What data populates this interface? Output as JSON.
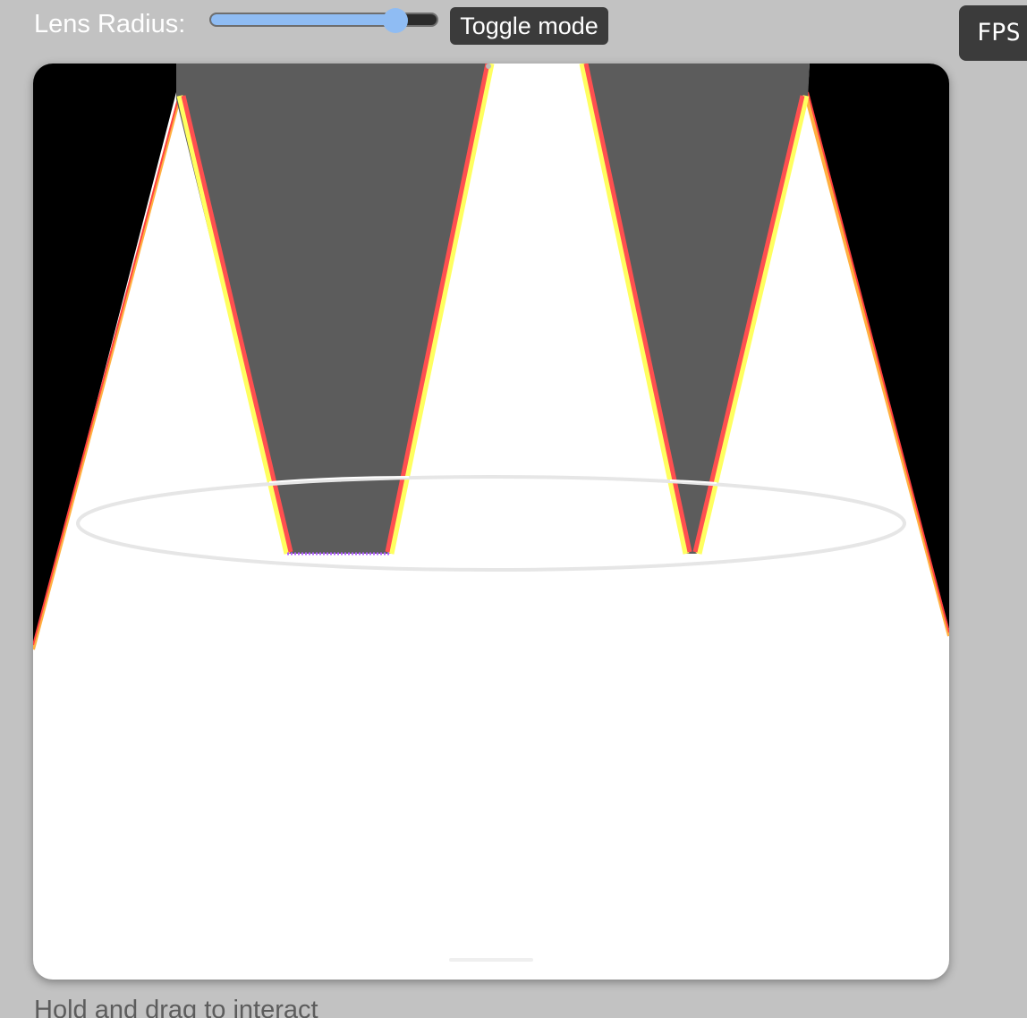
{
  "controls": {
    "lens_radius_label": "Lens Radius:",
    "lens_radius_value": 0.85,
    "toggle_label": "Toggle mode"
  },
  "fps_label": "FPS",
  "hint": "Hold and drag to interact",
  "colors": {
    "background": "#c2c2c2",
    "canvas_background": "#ffffff",
    "slider_accent": "#8fbcf3",
    "button_background": "#3b3b3b",
    "shadow_region": "#5c5c5c",
    "outside_region": "#000000",
    "edge_red": "#ff5050",
    "edge_yellow": "#ffff60"
  }
}
